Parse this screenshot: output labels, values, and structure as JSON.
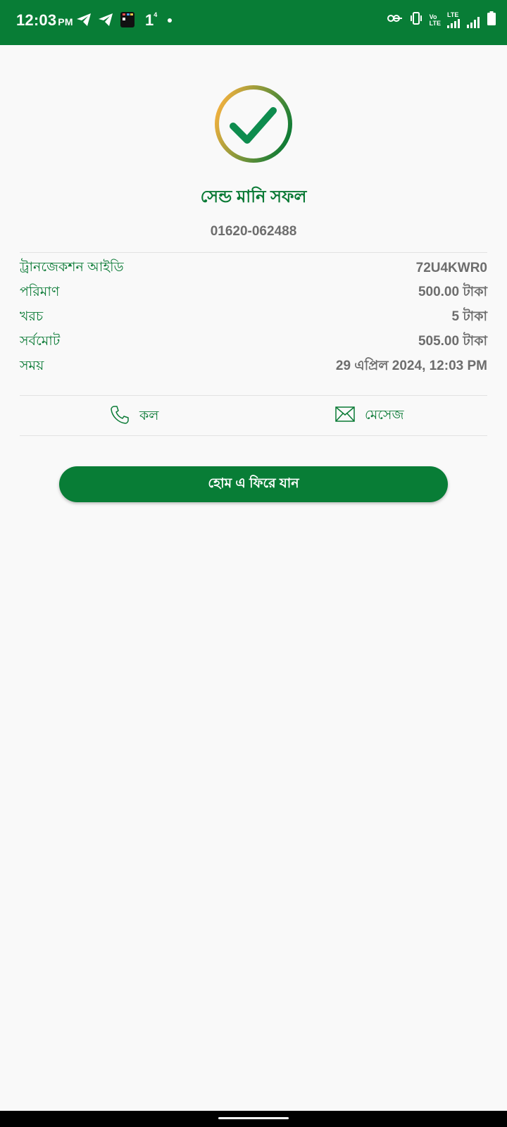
{
  "status_bar": {
    "time": "12:03",
    "ampm": "PM",
    "notif_count": "1",
    "notif_sup": "4",
    "network_type": "LTE",
    "volte_top": "Vo",
    "volte_bottom": "LTE"
  },
  "result": {
    "title": "সেন্ড মানি সফল",
    "phone": "01620-062488"
  },
  "details": [
    {
      "label": "ট্রানজেকশন আইডি",
      "value": "72U4KWR0"
    },
    {
      "label": "পরিমাণ",
      "value": "500.00 টাকা"
    },
    {
      "label": "খরচ",
      "value": "5 টাকা"
    },
    {
      "label": "সর্বমোট",
      "value": "505.00 টাকা"
    },
    {
      "label": "সময়",
      "value": "29 এপ্রিল 2024, 12:03 PM"
    }
  ],
  "actions": {
    "call_label": "কল",
    "message_label": "মেসেজ"
  },
  "home_button_label": "হোম এ ফিরে যান",
  "colors": {
    "brand_green": "#087d36",
    "label_green": "#0a7a35",
    "value_gray": "#6d6d6d",
    "ring_gradient_start": "#f0b03f",
    "ring_gradient_end": "#0a7a35"
  },
  "icons": {
    "success": "check-circle-icon",
    "call": "phone-icon",
    "message": "envelope-icon"
  }
}
